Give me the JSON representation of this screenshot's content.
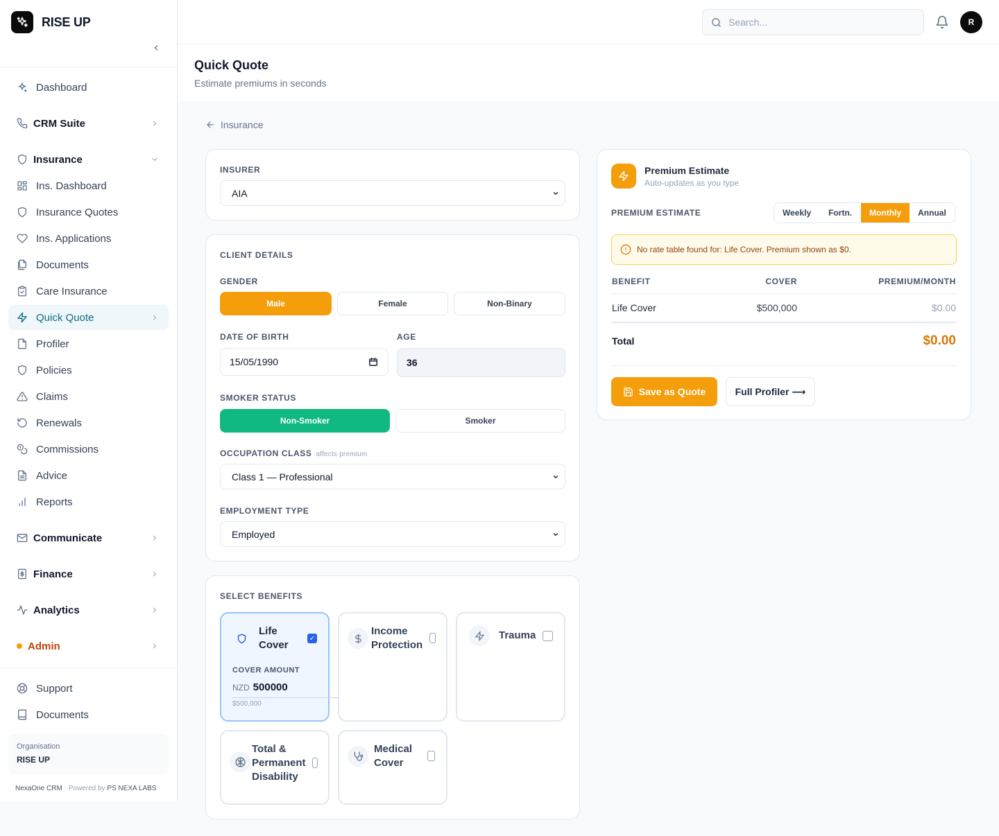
{
  "brand": {
    "name": "RISE UP"
  },
  "sidebar": {
    "dashboard": "Dashboard",
    "crm": "CRM Suite",
    "insurance": "Insurance",
    "insurance_items": [
      "Ins. Dashboard",
      "Insurance Quotes",
      "Ins. Applications",
      "Documents",
      "Care Insurance",
      "Quick Quote",
      "Profiler",
      "Policies",
      "Claims",
      "Renewals",
      "Commissions",
      "Advice",
      "Reports"
    ],
    "communicate": "Communicate",
    "finance": "Finance",
    "analytics": "Analytics",
    "admin": "Admin",
    "support": "Support",
    "documents": "Documents",
    "org_label": "Organisation",
    "org_name": "RISE UP",
    "footer_app": "NexaOne CRM",
    "footer_sep": "·",
    "footer_powered": "Powered by",
    "footer_company": "PS NEXA LABS"
  },
  "topbar": {
    "search_placeholder": "Search...",
    "avatar_initial": "R"
  },
  "page": {
    "title": "Quick Quote",
    "subtitle": "Estimate premiums in seconds",
    "back_label": "Insurance"
  },
  "insurer": {
    "label": "INSURER",
    "value": "AIA"
  },
  "client": {
    "section_label": "CLIENT DETAILS",
    "gender_label": "GENDER",
    "gender_options": [
      "Male",
      "Female",
      "Non-Binary"
    ],
    "dob_label": "DATE OF BIRTH",
    "dob_value": "15/05/1990",
    "age_label": "AGE",
    "age_value": "36",
    "smoker_label": "SMOKER STATUS",
    "smoker_options": [
      "Non-Smoker",
      "Smoker"
    ],
    "occupation_label": "OCCUPATION CLASS",
    "occupation_hint": "affects premium",
    "occupation_value": "Class 1 — Professional",
    "employment_label": "EMPLOYMENT TYPE",
    "employment_value": "Employed"
  },
  "benefits": {
    "section_label": "SELECT BENEFITS",
    "life": {
      "name_l1": "Life",
      "name_l2": "Cover",
      "check": "✓",
      "cover_label": "COVER AMOUNT",
      "currency": "NZD",
      "amount": "500000",
      "formatted": "$500,000"
    },
    "income": {
      "name_l1": "Income",
      "name_l2": "Protection"
    },
    "trauma": {
      "name": "Trauma"
    },
    "tpd": {
      "name_l1": "Total &",
      "name_l2": "Permanent",
      "name_l3": "Disability"
    },
    "medical": {
      "name_l1": "Medical",
      "name_l2": "Cover"
    }
  },
  "premium": {
    "title": "Premium Estimate",
    "subtitle": "Auto-updates as you type",
    "estimate_label": "PREMIUM ESTIMATE",
    "frequencies": [
      "Weekly",
      "Fortn.",
      "Monthly",
      "Annual"
    ],
    "selected_frequency": "Monthly",
    "warning": "No rate table found for: Life Cover. Premium shown as $0.",
    "columns": [
      "BENEFIT",
      "COVER",
      "PREMIUM/MONTH"
    ],
    "rows": [
      {
        "benefit": "Life Cover",
        "cover": "$500,000",
        "premium": "$0.00"
      }
    ],
    "total_label": "Total",
    "total_value": "$0.00",
    "save_button": "Save as Quote",
    "profiler_button": "Full Profiler ⟶"
  },
  "colors": {
    "accent": "#f59e0b",
    "success": "#10b981",
    "active_nav": "#0e6b82",
    "checkbox": "#2563eb"
  }
}
